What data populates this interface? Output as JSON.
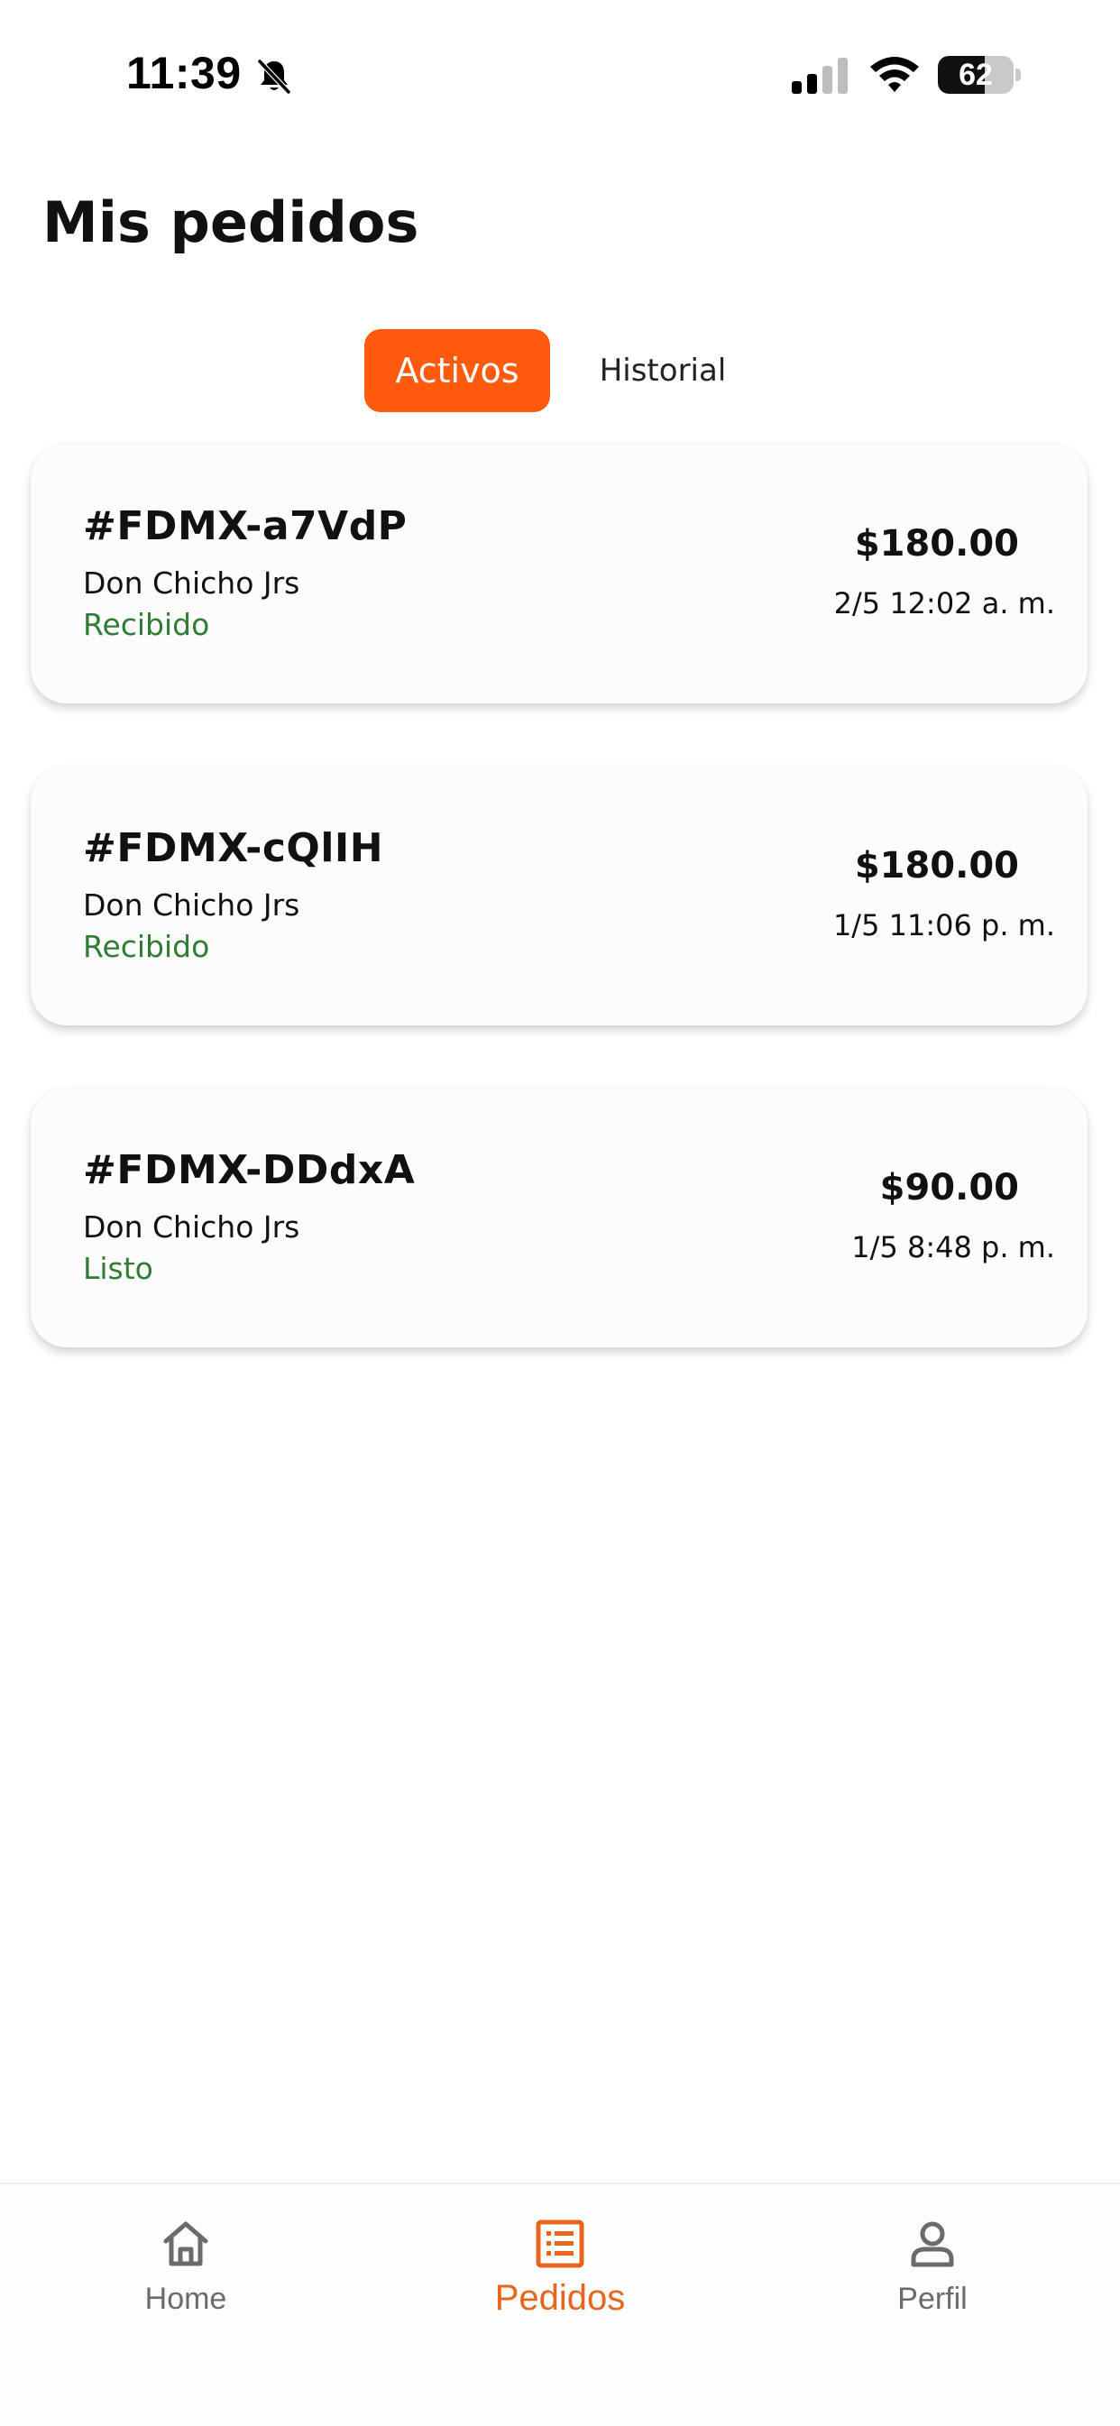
{
  "status_bar": {
    "time": "11:39",
    "battery_level": "62",
    "battery_fraction": 0.62,
    "icons": [
      "bell-muted-icon",
      "cellular-signal-icon",
      "wifi-icon",
      "battery-icon"
    ]
  },
  "page": {
    "title": "Mis pedidos"
  },
  "tabs": [
    {
      "label": "Activos",
      "active": true
    },
    {
      "label": "Historial",
      "active": false
    }
  ],
  "orders": [
    {
      "id": "#FDMX-a7VdP",
      "store": "Don Chicho Jrs",
      "status": "Recibido",
      "total": "$180.00",
      "date": "2/5 12:02 a. m."
    },
    {
      "id": "#FDMX-cQlIH",
      "store": "Don Chicho Jrs",
      "status": "Recibido",
      "total": "$180.00",
      "date": "1/5 11:06 p. m."
    },
    {
      "id": "#FDMX-DDdxA",
      "store": "Don Chicho Jrs",
      "status": "Listo",
      "total": "$90.00",
      "date": "1/5 8:48 p. m."
    }
  ],
  "bottom_nav": [
    {
      "label": "Home",
      "icon": "home-icon",
      "active": false
    },
    {
      "label": "Pedidos",
      "icon": "list-icon",
      "active": true
    },
    {
      "label": "Perfil",
      "icon": "user-icon",
      "active": false
    }
  ],
  "colors": {
    "accent": "#ff5a0d",
    "nav_active": "#e8651e",
    "status_green": "#2e7d32",
    "nav_inactive": "#6b6b6b"
  }
}
